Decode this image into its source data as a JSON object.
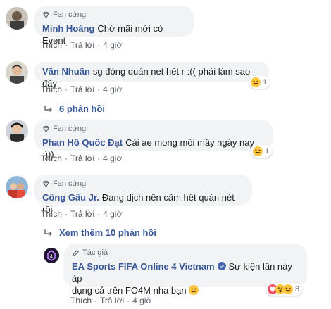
{
  "comments": [
    {
      "badge": "Fan cứng",
      "name": "Minh Hoàng",
      "text": "Chờ mãi mới có Event",
      "like": "Thích",
      "reply": "Trả lời",
      "time": "4 giờ"
    },
    {
      "badge": "",
      "name": "Văn Nhuần",
      "text": "sg đóng quán net hết r :(( phải làm sao đây",
      "like": "Thích",
      "reply": "Trả lời",
      "time": "4 giờ",
      "reaction_count": "1",
      "replies_link": "6 phản hồi"
    },
    {
      "badge": "Fan cứng",
      "name": "Phan Hồ Quốc Đạt",
      "text": "Cái ae mong mỏi mấy ngày nay :)))",
      "like": "Thích",
      "reply": "Trả lời",
      "time": "4 giờ",
      "reaction_count": "1"
    },
    {
      "badge": "Fan cứng",
      "name": "Công Gấu Jr.",
      "text": "Đang dịch nên cấm hết quán nét rồi",
      "like": "Thích",
      "reply": "Trả lời",
      "time": "4 giờ",
      "replies_link": "Xem thêm 10 phản hồi"
    }
  ],
  "author_reply": {
    "badge": "Tác giả",
    "name": "EA Sports FIFA Online 4 Vietnam",
    "text_line1": "Sự kiện lần này áp",
    "text_line2": "dụng cả trên FO4M nha bạn",
    "like": "Thích",
    "reply": "Trả lời",
    "time": "4 giờ",
    "reaction_count": "8"
  },
  "colors": {
    "link": "#385898",
    "bubble": "#f2f3f5",
    "meta": "#606770",
    "verified": "#4267b2"
  },
  "icons": [
    "diamond-icon",
    "pencil-icon",
    "reply-arrow-icon",
    "verified-badge-icon",
    "haha-emoji-icon",
    "love-emoji-icon",
    "wow-emoji-icon",
    "smile-emoji-icon"
  ]
}
